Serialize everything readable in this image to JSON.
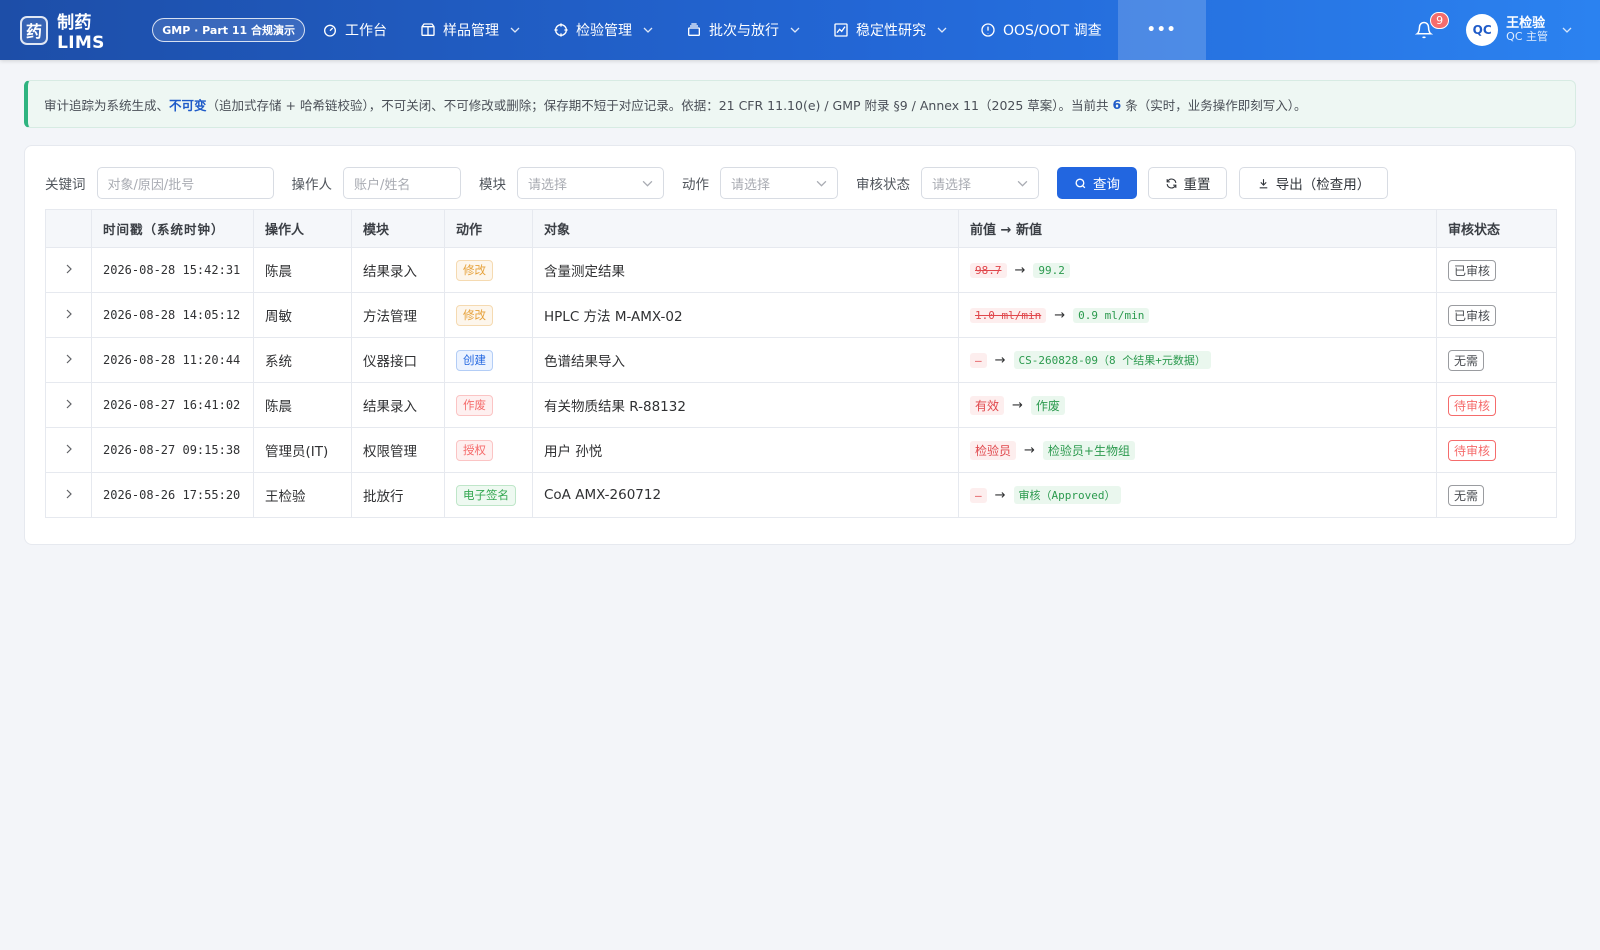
{
  "header": {
    "logo_char": "药",
    "app_name": "制药 LIMS",
    "badge": "GMP · Part 11 合规演示",
    "nav": [
      {
        "label": "工作台",
        "icon": "dashboard-icon",
        "has_dropdown": false
      },
      {
        "label": "样品管理",
        "icon": "box-icon",
        "has_dropdown": true
      },
      {
        "label": "检验管理",
        "icon": "crosshair-icon",
        "has_dropdown": true
      },
      {
        "label": "批次与放行",
        "icon": "layers-icon",
        "has_dropdown": true
      },
      {
        "label": "稳定性研究",
        "icon": "trend-chart-icon",
        "has_dropdown": true
      },
      {
        "label": "OOS/OOT 调查",
        "icon": "alert-circle-icon",
        "has_dropdown": false
      }
    ],
    "more_label": "•••",
    "notification_count": "9",
    "user": {
      "avatar": "QC",
      "name": "王检验",
      "role": "QC 主管"
    }
  },
  "notice": {
    "prefix": "审计追踪为系统生成、",
    "emphasis": "不可变",
    "middle": "（追加式存储 + 哈希链校验），不可关闭、不可修改或删除；保存期不短于对应记录。依据：21 CFR 11.10(e) / GMP 附录 §9 / Annex 11（2025 草案）。当前共",
    "count": "6",
    "suffix": "条（实时，业务操作即刻写入）。"
  },
  "filters": {
    "keyword_label": "关键词",
    "keyword_placeholder": "对象/原因/批号",
    "operator_label": "操作人",
    "operator_placeholder": "账户/姓名",
    "module_label": "模块",
    "module_placeholder": "请选择",
    "action_label": "动作",
    "action_placeholder": "请选择",
    "review_label": "审核状态",
    "review_placeholder": "请选择",
    "search_button": "查询",
    "reset_button": "重置",
    "export_button": "导出（检查用）"
  },
  "table": {
    "columns": [
      "",
      "时间戳（系统时钟）",
      "操作人",
      "模块",
      "动作",
      "对象",
      "前值 → 新值",
      "审核状态"
    ],
    "rows": [
      {
        "time": "2026-08-28 15:42:31",
        "operator": "陈晨",
        "module": "结果录入",
        "action": "修改",
        "action_color": "orange",
        "object": "含量测定结果",
        "old": "98.7",
        "new": "99.2",
        "strike": true,
        "mono": true,
        "status": "已审核",
        "status_type": "done"
      },
      {
        "time": "2026-08-28 14:05:12",
        "operator": "周敏",
        "module": "方法管理",
        "action": "修改",
        "action_color": "orange",
        "object": "HPLC 方法 M-AMX-02",
        "old": "1.0 ml/min",
        "new": "0.9 ml/min",
        "strike": true,
        "mono": true,
        "status": "已审核",
        "status_type": "done"
      },
      {
        "time": "2026-08-28 11:20:44",
        "operator": "系统",
        "module": "仪器接口",
        "action": "创建",
        "action_color": "blue",
        "object": "色谱结果导入",
        "old": "–",
        "new": "CS-260828-09（8 个结果+元数据）",
        "strike": false,
        "mono": true,
        "status": "无需",
        "status_type": "none"
      },
      {
        "time": "2026-08-27 16:41:02",
        "operator": "陈晨",
        "module": "结果录入",
        "action": "作废",
        "action_color": "red",
        "object": "有关物质结果 R-88132",
        "old": "有效",
        "new": "作废",
        "strike": false,
        "mono": false,
        "status": "待审核",
        "status_type": "pending"
      },
      {
        "time": "2026-08-27 09:15:38",
        "operator": "管理员(IT)",
        "module": "权限管理",
        "action": "授权",
        "action_color": "red",
        "object": "用户 孙悦",
        "old": "检验员",
        "new": "检验员+生物组",
        "strike": false,
        "mono": false,
        "status": "待审核",
        "status_type": "pending"
      },
      {
        "time": "2026-08-26 17:55:20",
        "operator": "王检验",
        "module": "批放行",
        "action": "电子签名",
        "action_color": "green",
        "object": "CoA AMX-260712",
        "old": "–",
        "new": "审核（Approved）",
        "strike": false,
        "mono": true,
        "status": "无需",
        "status_type": "none"
      }
    ]
  },
  "colors": {
    "header_start": "#1d4ea8",
    "header_end": "#2b82f0",
    "primary": "#2266e0",
    "notice_accent": "#2fb380",
    "danger": "#f56c6c",
    "warning": "#e6a23c",
    "success": "#35a852"
  }
}
